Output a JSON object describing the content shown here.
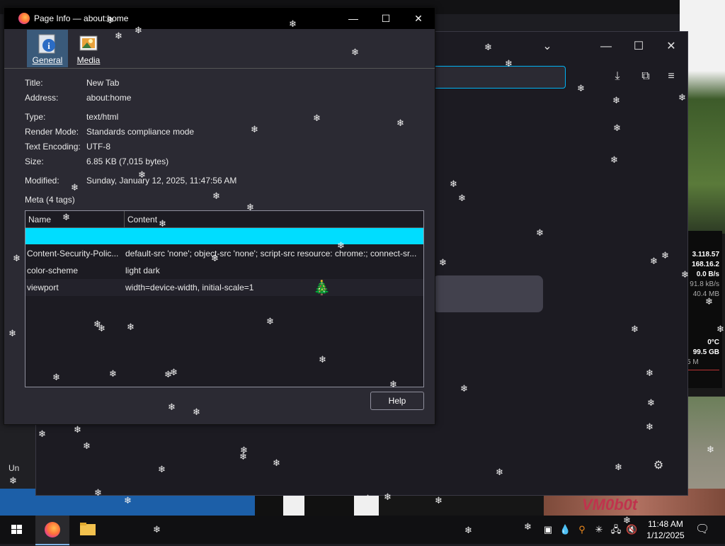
{
  "desktop": {
    "partial_label": "Un",
    "widget_values": [
      "3.118.57",
      "168.16.2",
      "0.0 B/s",
      "91.8 kB/s",
      "40.4 MB",
      "0°C",
      "99.5 GB",
      "5 M"
    ],
    "watermark": "VM0b0t"
  },
  "dialog": {
    "title": "Page Info — about:home",
    "tabs": [
      {
        "label": "General",
        "icon": "info-icon",
        "selected": true
      },
      {
        "label": "Media",
        "icon": "image-icon",
        "selected": false
      }
    ],
    "fields": {
      "title_label": "Title:",
      "title_value": "New Tab",
      "address_label": "Address:",
      "address_value": "about:home",
      "type_label": "Type:",
      "type_value": "text/html",
      "render_label": "Render Mode:",
      "render_value": "Standards compliance mode",
      "encoding_label": "Text Encoding:",
      "encoding_value": "UTF-8",
      "size_label": "Size:",
      "size_value": "6.85 KB (7,015 bytes)",
      "modified_label": "Modified:",
      "modified_value": "Sunday, January 12, 2025, 11:47:56 AM"
    },
    "meta_title": "Meta (4 tags)",
    "meta_columns": [
      "Name",
      "Content"
    ],
    "meta_rows": [
      {
        "name": "Content-Security-Polic...",
        "content": "default-src 'none'; object-src 'none'; script-src resource: chrome:; connect-sr..."
      },
      {
        "name": "color-scheme",
        "content": "light dark"
      },
      {
        "name": "viewport",
        "content": "width=device-width, initial-scale=1"
      }
    ],
    "help_label": "Help"
  },
  "taskbar": {
    "time": "11:48 AM",
    "date": "1/12/2025"
  }
}
